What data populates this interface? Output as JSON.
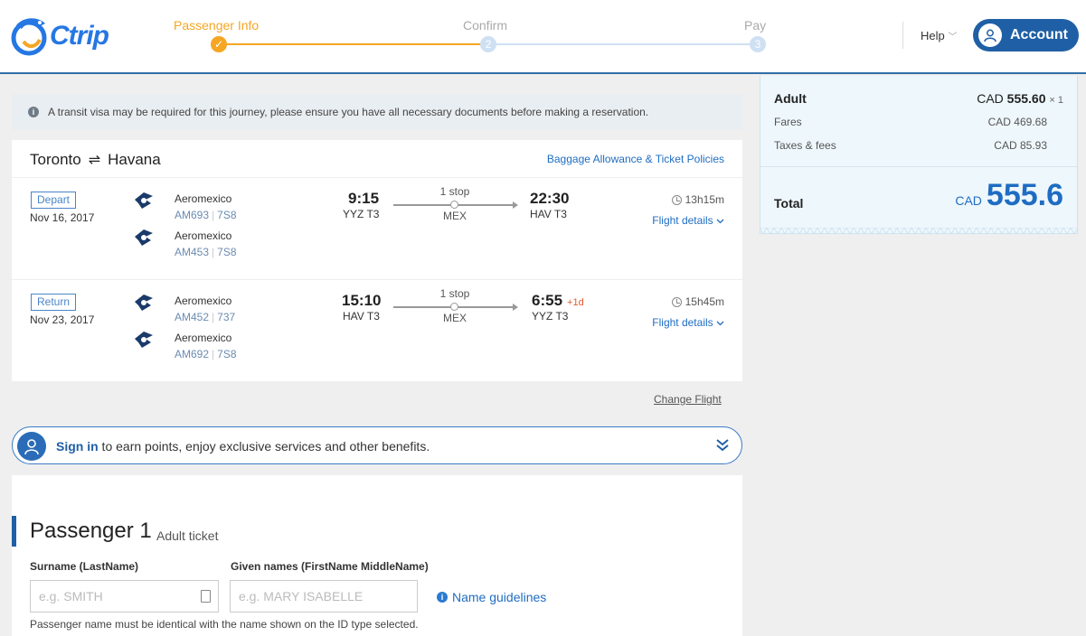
{
  "header": {
    "logo_text": "Ctrip",
    "steps": [
      {
        "label": "Passenger Info",
        "status": "done",
        "num": "✓"
      },
      {
        "label": "Confirm",
        "status": "pending",
        "num": "2"
      },
      {
        "label": "Pay",
        "status": "pending",
        "num": "3"
      }
    ],
    "help_label": "Help",
    "account_label": "Account"
  },
  "notice": {
    "text": "A transit visa may be required for this journey, please ensure you have all necessary documents before making a reservation."
  },
  "flight": {
    "origin": "Toronto",
    "destination": "Havana",
    "arrow": "⇌",
    "baggage_link": "Baggage Allowance & Ticket Policies",
    "depart": {
      "tag": "Depart",
      "date": "Nov 16, 2017",
      "legs": [
        {
          "airline": "Aeromexico",
          "flight": "AM693",
          "aircraft": "7S8"
        },
        {
          "airline": "Aeromexico",
          "flight": "AM453",
          "aircraft": "7S8"
        }
      ],
      "dep_time": "9:15",
      "dep_airport": "YYZ T3",
      "stops": "1 stop",
      "via": "MEX",
      "arr_time": "22:30",
      "arr_airport": "HAV T3",
      "plus_day": "",
      "duration": "13h15m",
      "details": "Flight details"
    },
    "return": {
      "tag": "Return",
      "date": "Nov 23, 2017",
      "legs": [
        {
          "airline": "Aeromexico",
          "flight": "AM452",
          "aircraft": "737"
        },
        {
          "airline": "Aeromexico",
          "flight": "AM692",
          "aircraft": "7S8"
        }
      ],
      "dep_time": "15:10",
      "dep_airport": "HAV T3",
      "stops": "1 stop",
      "via": "MEX",
      "arr_time": "6:55",
      "arr_airport": "YYZ T3",
      "plus_day": "+1d",
      "duration": "15h45m",
      "details": "Flight details"
    },
    "change_flight": "Change Flight"
  },
  "signin": {
    "link": "Sign in",
    "text": " to earn points, enjoy exclusive services and other benefits."
  },
  "passenger": {
    "title": "Passenger 1",
    "subtitle": "Adult ticket",
    "surname_label": "Surname (LastName)",
    "surname_placeholder": "e.g. SMITH",
    "given_label": "Given names (FirstName MiddleName)",
    "given_placeholder": "e.g. MARY ISABELLE",
    "guidelines": "Name guidelines",
    "note": "Passenger name must be identical with the name shown on the ID type selected."
  },
  "price": {
    "adult_label": "Adult",
    "adult_currency": "CAD",
    "adult_value": "555.60",
    "adult_mult": "× 1",
    "fares_label": "Fares",
    "fares_value": "CAD 469.68",
    "taxes_label": "Taxes & fees",
    "taxes_value": "CAD 85.93",
    "total_label": "Total",
    "total_currency": "CAD",
    "total_value": "555.6"
  },
  "colors": {
    "accent": "#1f5fa5",
    "step_active": "#f5a623",
    "link": "#1f6dc2"
  }
}
